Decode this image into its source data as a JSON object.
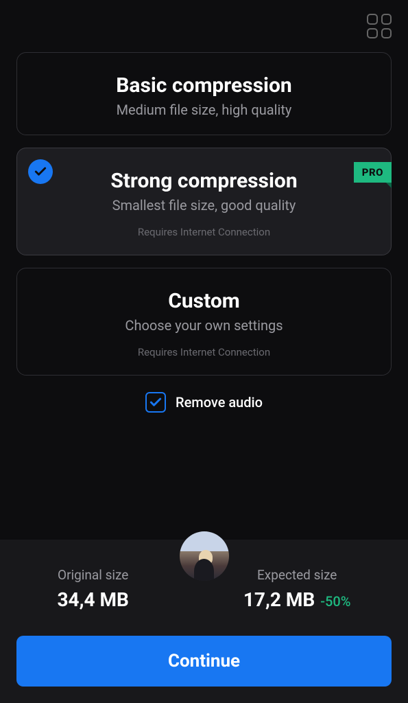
{
  "options": {
    "basic": {
      "title": "Basic compression",
      "subtitle": "Medium file size, high quality"
    },
    "strong": {
      "title": "Strong compression",
      "subtitle": "Smallest file size, good quality",
      "note": "Requires Internet Connection",
      "pro_label": "PRO"
    },
    "custom": {
      "title": "Custom",
      "subtitle": "Choose your own settings",
      "note": "Requires Internet Connection"
    }
  },
  "remove_audio": {
    "label": "Remove audio",
    "checked": true
  },
  "sizes": {
    "original_label": "Original size",
    "original_value": "34,4 MB",
    "expected_label": "Expected size",
    "expected_value": "17,2 MB",
    "reduction": "-50%"
  },
  "continue_label": "Continue"
}
